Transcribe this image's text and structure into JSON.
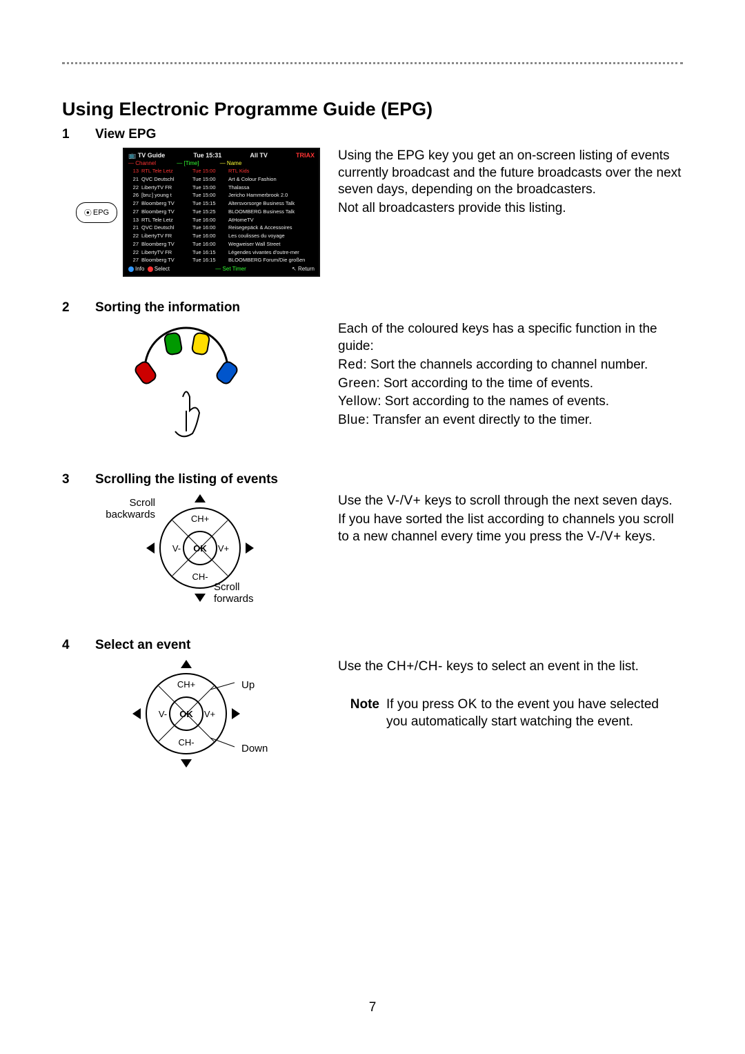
{
  "heading": "Using Electronic Programme Guide (EPG)",
  "page_number": "7",
  "sections": {
    "s1": {
      "num": "1",
      "title": "View EPG"
    },
    "s2": {
      "num": "2",
      "title": "Sorting the information"
    },
    "s3": {
      "num": "3",
      "title": "Scrolling the listing of events"
    },
    "s4": {
      "num": "4",
      "title": "Select an event"
    }
  },
  "epg_button_label": "EPG",
  "epg_screen": {
    "title": "TV Guide",
    "time": "Tue 15:31",
    "filter": "All TV",
    "brand": "TRIAX",
    "legend_channel": "Channel",
    "legend_time": "[Time]",
    "legend_name": "Name",
    "rows": [
      {
        "n": "13",
        "ch": "RTL Tele Letz",
        "t": "Tue  15:00",
        "name": "RTL Kids"
      },
      {
        "n": "21",
        "ch": "QVC Deutschl",
        "t": "Tue  15:00",
        "name": "Art & Colour Fashion"
      },
      {
        "n": "22",
        "ch": "LibertyTV FR",
        "t": "Tue  15:00",
        "name": "Thalassa"
      },
      {
        "n": "26",
        "ch": "[bru:] young t",
        "t": "Tue  15:00",
        "name": "Jericho Hammerbrook 2.0"
      },
      {
        "n": "27",
        "ch": "Bloomberg TV",
        "t": "Tue  15:15",
        "name": "Altersvorsorge Business Talk"
      },
      {
        "n": "27",
        "ch": "Bloomberg TV",
        "t": "Tue  15:25",
        "name": "BLOOMBERG Business Talk"
      },
      {
        "n": "13",
        "ch": "RTL Tele Letz",
        "t": "Tue  16:00",
        "name": "AtHomeTV"
      },
      {
        "n": "21",
        "ch": "QVC Deutschl",
        "t": "Tue  16:00",
        "name": "Reisegepäck & Accessoires"
      },
      {
        "n": "22",
        "ch": "LibertyTV FR",
        "t": "Tue  16:00",
        "name": "Les coulisses du voyage"
      },
      {
        "n": "27",
        "ch": "Bloomberg TV",
        "t": "Tue  16:00",
        "name": "Wegweiser Wall Street"
      },
      {
        "n": "22",
        "ch": "LibertyTV FR",
        "t": "Tue  16:15",
        "name": "Légendes vivantes d'outre-mer"
      },
      {
        "n": "27",
        "ch": "Bloomberg TV",
        "t": "Tue  16:15",
        "name": "BLOOMBERG Forum/Die großen"
      }
    ],
    "foot_info": "Info",
    "foot_select": "Select",
    "foot_timer": "Set Timer",
    "foot_return": "Return"
  },
  "body": {
    "s1_p1": "Using the EPG key you get an on-screen listing of events currently broadcast and the future broadcasts over the next seven days, depending on the broadcasters.",
    "s1_p2": "Not all broadcasters provide this listing.",
    "s2_intro": "Each of the coloured keys has a specific function in the guide:",
    "s2_red_lbl": "Red",
    "s2_red": ": Sort the channels according to channel number.",
    "s2_green_lbl": "Green",
    "s2_green": ": Sort according to the time of events.",
    "s2_yellow_lbl": "Yellow",
    "s2_yellow": ": Sort according to the names of events.",
    "s2_blue_lbl": "Blue",
    "s2_blue": ": Transfer an event directly to the timer.",
    "s3_p1a": "Use the ",
    "s3_keys": "V-/V+",
    "s3_p1b": " keys to scroll through the next seven days.",
    "s3_p2a": "If you have sorted the list according to channels you scroll to a new channel every time you press the ",
    "s3_p2b": " keys.",
    "s4_p1a": "Use the ",
    "s4_keys": "CH+/CH-",
    "s4_p1b": " keys to select an event in the list.",
    "note_lbl": "Note",
    "note_a": "If you press ",
    "note_ok": "OK",
    "note_b": " to the event you have selected you automatically start watching the event."
  },
  "nav_labels": {
    "scroll_back": "Scroll\nbackwards",
    "scroll_fwd": "Scroll\nforwards",
    "up": "Up",
    "down": "Down",
    "ch_plus": "CH+",
    "ch_minus": "CH-",
    "v_plus": "V+",
    "v_minus": "V-",
    "ok": "OK"
  }
}
